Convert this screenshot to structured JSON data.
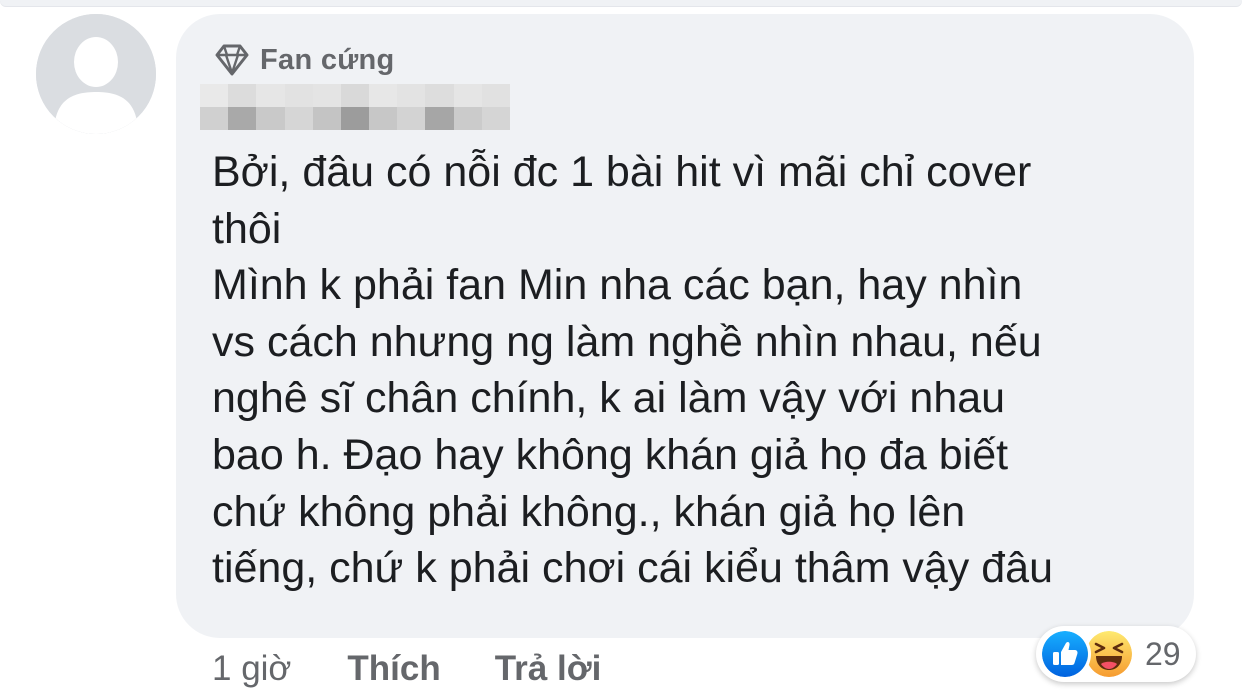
{
  "comment": {
    "badge_label": "Fan cứng",
    "text_lines": [
      "Bởi, đâu có nỗi đc 1 bài hit vì mãi chỉ cover",
      "thôi",
      "Mình k phải fan Min nha các bạn, hay nhìn",
      "vs cách nhưng ng làm nghề nhìn nhau, nếu",
      "nghê sĩ chân chính, k ai làm vậy với nhau",
      "bao h. Đạo hay không khán giả họ đa biết",
      "chứ không phải không., khán giả họ lên",
      "tiếng, chứ k phải chơi cái kiểu thâm vậy đâu"
    ],
    "time": "1 giờ",
    "like_label": "Thích",
    "reply_label": "Trả lời",
    "reaction_count": "29",
    "reaction_icons": [
      "like-icon",
      "haha-icon"
    ]
  },
  "colors": {
    "bubble_bg": "#f0f2f5",
    "text": "#1c1e21",
    "secondary_text": "#65676b",
    "like_blue": "#1877f2",
    "haha_yellow": "#f7b928"
  }
}
